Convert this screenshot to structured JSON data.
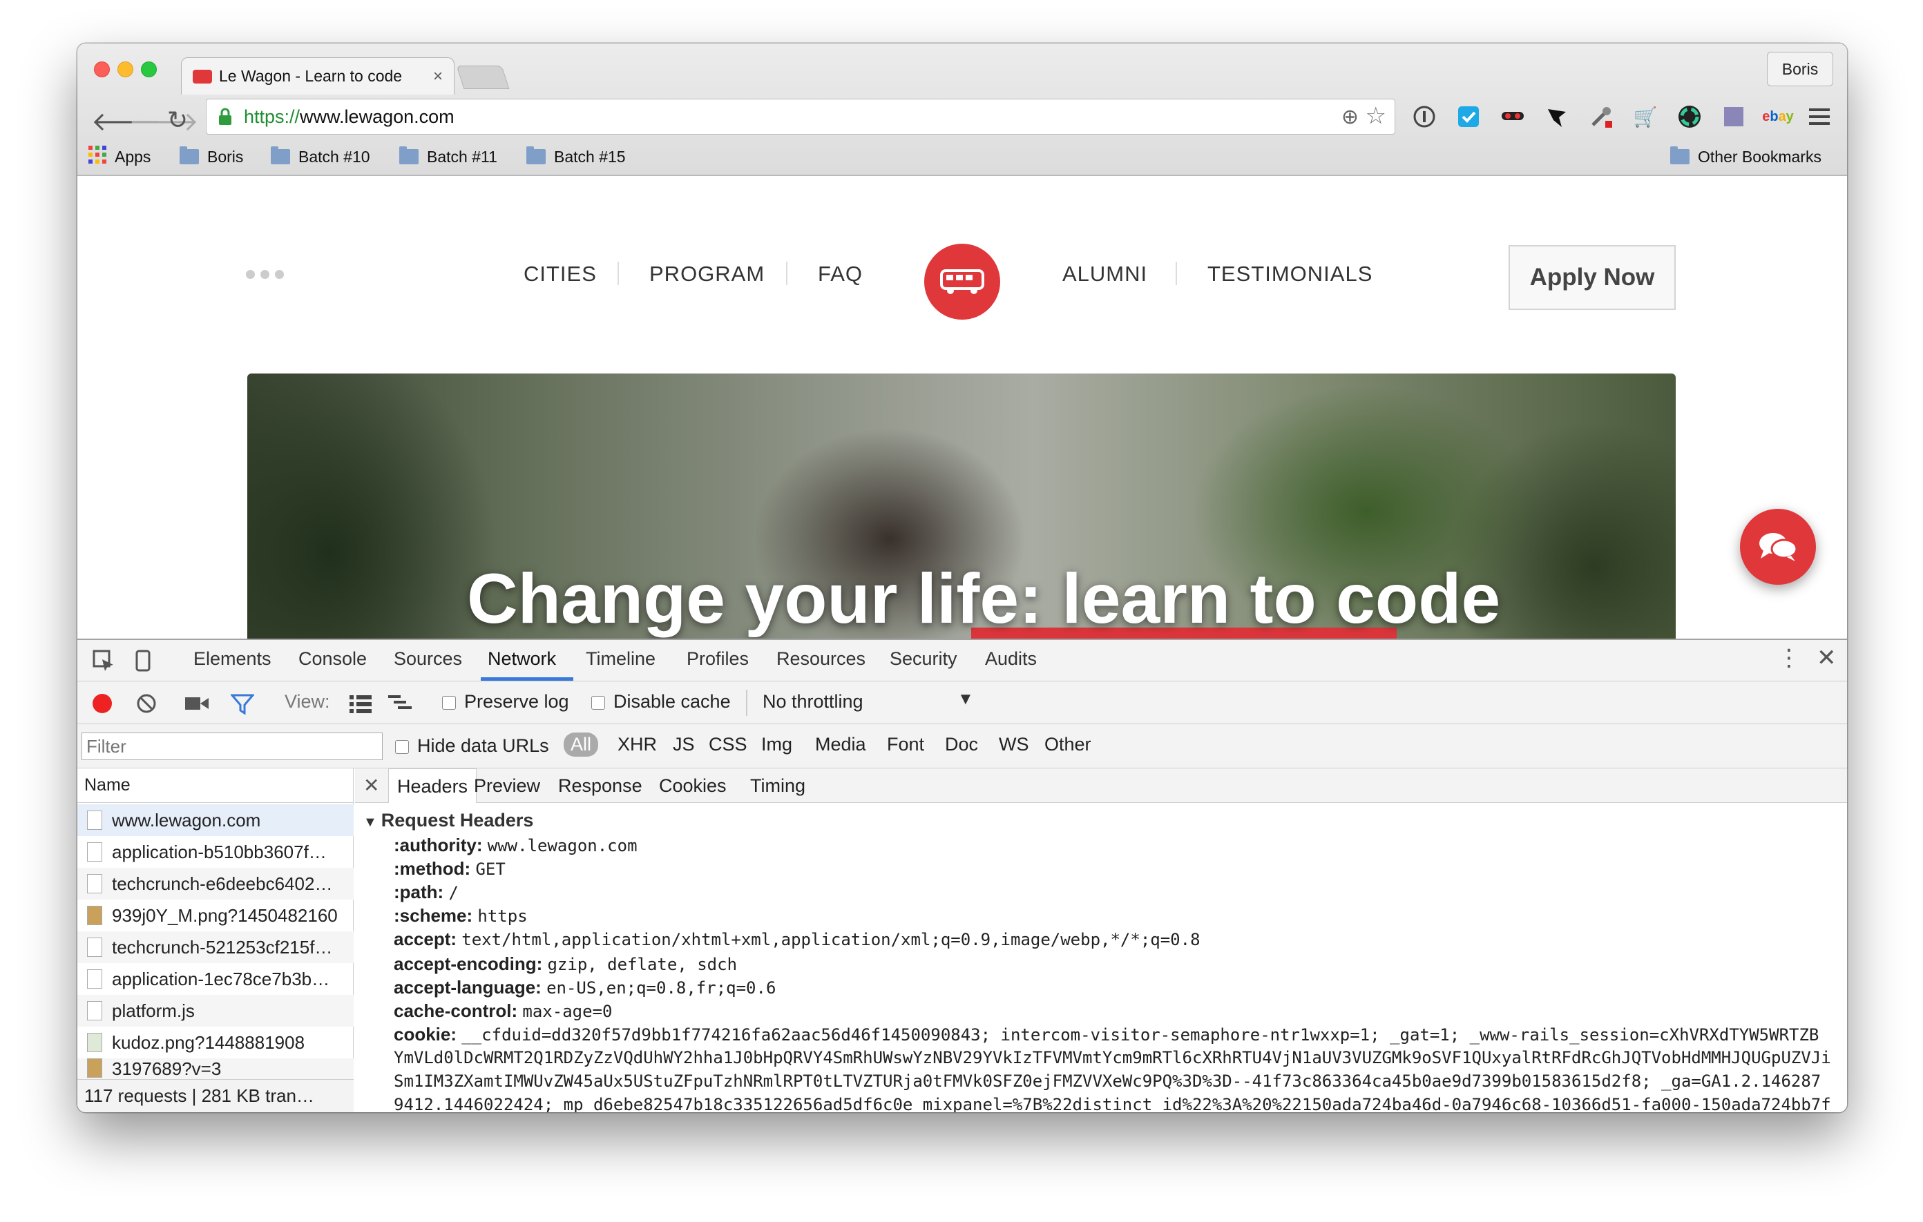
{
  "browser": {
    "tab_title": "Le Wagon - Learn to code",
    "tab_close": "×",
    "user_label": "Boris",
    "url_prefix": "https://",
    "url_rest": "www.lewagon.com",
    "extension_ebay": "ebay"
  },
  "bookmarks": {
    "apps_label": "Apps",
    "items": [
      "Boris",
      "Batch #10",
      "Batch #11",
      "Batch #15"
    ],
    "other": "Other Bookmarks"
  },
  "site": {
    "nav": [
      "CITIES",
      "PROGRAM",
      "FAQ",
      "ALUMNI",
      "TESTIMONIALS"
    ],
    "apply_label": "Apply Now",
    "hero_text": "Change your life: learn to code",
    "brand_color": "#e0373b"
  },
  "devtools": {
    "tabs": [
      "Elements",
      "Console",
      "Sources",
      "Network",
      "Timeline",
      "Profiles",
      "Resources",
      "Security",
      "Audits"
    ],
    "active_tab": "Network",
    "view_label": "View:",
    "preserve_log": "Preserve log",
    "disable_cache": "Disable cache",
    "throttling": "No throttling",
    "filter_placeholder": "Filter",
    "hide_data_urls": "Hide data URLs",
    "types": [
      "All",
      "XHR",
      "JS",
      "CSS",
      "Img",
      "Media",
      "Font",
      "Doc",
      "WS",
      "Other"
    ],
    "name_header": "Name",
    "requests": [
      "www.lewagon.com",
      "application-b510bb3607f…",
      "techcrunch-e6deebc6402…",
      "939j0Y_M.png?1450482160",
      "techcrunch-521253cf215f…",
      "application-1ec78ce7b3b…",
      "platform.js",
      "kudoz.png?1448881908",
      "3197689?v=3"
    ],
    "status": "117 requests | 281 KB tran…",
    "detail_tabs": [
      "Headers",
      "Preview",
      "Response",
      "Cookies",
      "Timing"
    ],
    "section_title": "Request Headers",
    "headers": [
      {
        "k": ":authority:",
        "v": "www.lewagon.com"
      },
      {
        "k": ":method:",
        "v": "GET"
      },
      {
        "k": ":path:",
        "v": "/"
      },
      {
        "k": ":scheme:",
        "v": "https"
      },
      {
        "k": "accept:",
        "v": "text/html,application/xhtml+xml,application/xml;q=0.9,image/webp,*/*;q=0.8"
      },
      {
        "k": "accept-encoding:",
        "v": "gzip, deflate, sdch"
      },
      {
        "k": "accept-language:",
        "v": "en-US,en;q=0.8,fr;q=0.6"
      },
      {
        "k": "cache-control:",
        "v": "max-age=0"
      },
      {
        "k": "cookie:",
        "v": "__cfduid=dd320f57d9bb1f774216fa62aac56d46f1450090843; intercom-visitor-semaphore-ntr1wxxp=1; _gat=1; _www-rails_session=cXhVRXdTYW5WRTZB"
      }
    ],
    "cookie_cont": [
      "YmVLd0lDcWRMT2Q1RDZyZzVQdUhWY2hha1J0bHpQRVY4SmRhUWswYzNBV29YVkIzTFVMVmtYcm9mRTl6cXRhRTU4VjN1aUV3VUZGMk9oSVF1QUxyalRtRFdRcGhJQTVobHdMMHJQUGpUZVJi",
      "Sm1IM3ZXamtIMWUvZW45aUx5UStuZFpuTzhNRmlRPT0tLTVZTURja0tFMVk0SFZ0ejFMZVVXeWc9PQ%3D%3D--41f73c863364ca45b0ae9d7399b01583615d2f8; _ga=GA1.2.146287",
      "9412.1446022424; mp_d6ebe82547b18c335122656ad5df6c0e_mixpanel=%7B%22distinct_id%22%3A%20%22150ada724ba46d-0a7946c68-10366d51-fa000-150ada724bb7f"
    ]
  }
}
